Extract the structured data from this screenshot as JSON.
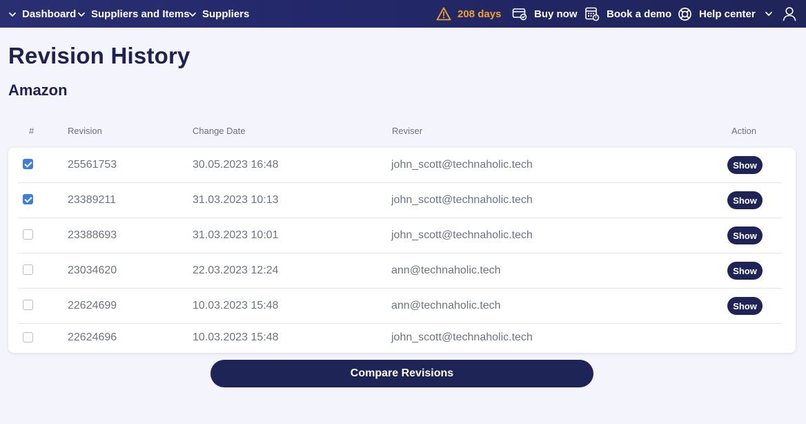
{
  "header": {
    "breadcrumbs": [
      {
        "label": "Dashboard",
        "icon": "chevron-down-icon"
      },
      {
        "label": "Suppliers and Items",
        "icon": "chevron-down-icon"
      },
      {
        "label": "Suppliers",
        "icon": "chevron-down-icon"
      }
    ],
    "trial": {
      "label": "208 days",
      "icon": "warning-icon",
      "color": "#f0a12f"
    },
    "buy_now": {
      "label": "Buy now",
      "icon": "card-icon"
    },
    "book_demo": {
      "label": "Book a demo",
      "icon": "calendar-icon"
    },
    "help_center": {
      "label": "Help center",
      "icon": "lifebuoy-icon"
    },
    "account": {
      "icons": [
        "chevron-down-icon",
        "user-icon"
      ]
    }
  },
  "page": {
    "title": "Revision History",
    "subtitle": "Amazon"
  },
  "table": {
    "columns": [
      "#",
      "Revision",
      "Change Date",
      "Reviser",
      "Action"
    ],
    "rows": [
      {
        "checked": true,
        "revision": "25561753",
        "date": "30.05.2023 16:48",
        "reviser": "john_scott@technaholic.tech",
        "action": "Show"
      },
      {
        "checked": true,
        "revision": "23389211",
        "date": "31.03.2023 10:13",
        "reviser": "john_scott@technaholic.tech",
        "action": "Show"
      },
      {
        "checked": false,
        "revision": "23388693",
        "date": "31.03.2023 10:01",
        "reviser": "john_scott@technaholic.tech",
        "action": "Show"
      },
      {
        "checked": false,
        "revision": "23034620",
        "date": "22.03.2023 12:24",
        "reviser": "ann@technaholic.tech",
        "action": "Show"
      },
      {
        "checked": false,
        "revision": "22624699",
        "date": "10.03.2023 15:48",
        "reviser": "ann@technaholic.tech",
        "action": "Show"
      },
      {
        "checked": false,
        "revision": "22624696",
        "date": "10.03.2023 15:48",
        "reviser": "john_scott@technaholic.tech",
        "action": ""
      }
    ]
  },
  "compare_button": {
    "label": "Compare Revisions"
  },
  "colors": {
    "header_bg": "#23286a",
    "primary": "#1f2456",
    "checkbox_checked": "#3f7fd8",
    "page_bg": "#f4f4fd",
    "trial_warning": "#f0a12f"
  }
}
